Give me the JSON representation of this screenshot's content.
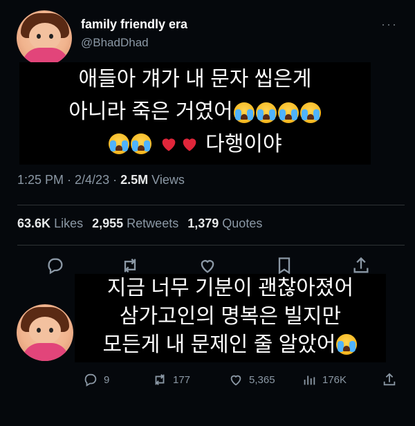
{
  "tweet": {
    "display_name": "family friendly era",
    "handle": "@BhadDhad",
    "time": "1:25 PM · 2/4/23 ·",
    "views_count": "2.5M",
    "views_label": "Views",
    "caption_lines": [
      "애들아 걔가 내 문자 씹은게",
      "아니라 죽은 거였어",
      "다행이야"
    ],
    "likes_count": "63.6K",
    "likes_label": "Likes",
    "retweets_count": "2,955",
    "retweets_label": "Retweets",
    "quotes_count": "1,379",
    "quotes_label": "Quotes",
    "more_label": "···"
  },
  "reply": {
    "caption_lines": [
      "지금 너무 기분이 괜찮아졌어",
      "삼가고인의 명복은 빌지만",
      "모든게 내 문제인 줄 알았어"
    ],
    "replies": "9",
    "retweets": "177",
    "likes": "5,365",
    "views": "176K"
  },
  "icons": {
    "reply": "comment-icon",
    "retweet": "retweet-icon",
    "like": "heart-icon",
    "views": "bar-chart-icon",
    "share": "share-icon",
    "emoji": "loudly-crying-face",
    "heart_emoji": "red-heart"
  },
  "colors": {
    "background": "#05080c",
    "text": "#e7e9ea",
    "muted": "#8b98a5",
    "divider": "#2f3336"
  }
}
